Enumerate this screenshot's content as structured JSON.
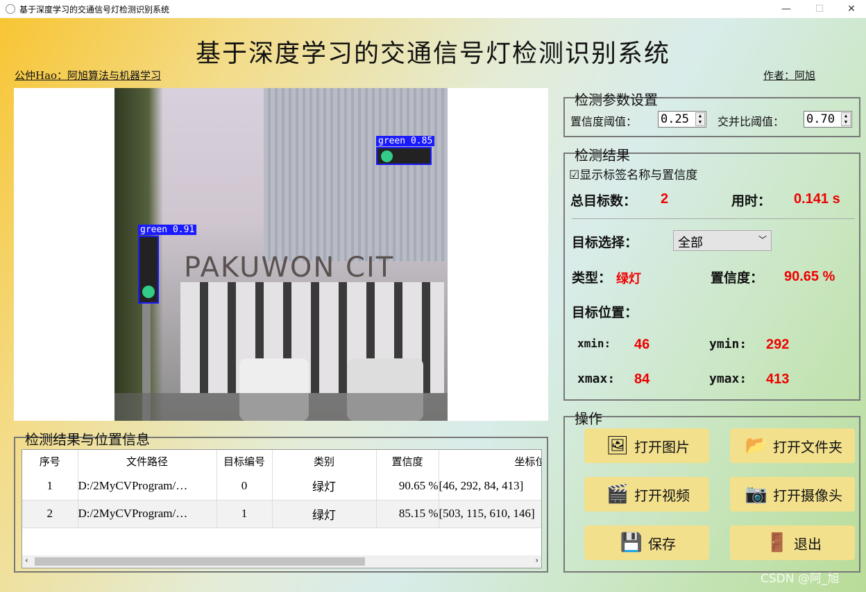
{
  "window": {
    "title": "基于深度学习的交通信号灯检测识别系统",
    "minimize": "—",
    "maximize": "☐",
    "close": "✕"
  },
  "header": {
    "title": "基于深度学习的交通信号灯检测识别系统",
    "left_note": "公仲Hao：阿旭算法与机器学习",
    "right_note": "作者：阿旭"
  },
  "image": {
    "detections": [
      {
        "label": "green 0.91"
      },
      {
        "label": "green 0.85"
      }
    ],
    "sign_text": "PAKUWON CIT"
  },
  "params": {
    "title": "检测参数设置",
    "conf_label": "置信度阈值：",
    "conf_value": "0.25",
    "iou_label": "交并比阈值：",
    "iou_value": "0.70"
  },
  "results": {
    "title": "检测结果",
    "show_labels": "显示标签名称与置信度",
    "show_labels_checked": true,
    "total_label": "总目标数：",
    "total_value": "2",
    "time_label": "用时：",
    "time_value": "0.141 s",
    "select_label": "目标选择：",
    "select_value": "全部",
    "type_label": "类型：",
    "type_value": "绿灯",
    "conf_label": "置信度：",
    "conf_value": "90.65 %",
    "pos_label": "目标位置：",
    "xmin_label": "xmin:",
    "xmin": "46",
    "ymin_label": "ymin:",
    "ymin": "292",
    "xmax_label": "xmax:",
    "xmax": "84",
    "ymax_label": "ymax:",
    "ymax": "413"
  },
  "ops": {
    "title": "操作",
    "open_image": "打开图片",
    "open_folder": "打开文件夹",
    "open_video": "打开视频",
    "open_camera": "打开摄像头",
    "save": "保存",
    "exit": "退出"
  },
  "table": {
    "title": "检测结果与位置信息",
    "columns": [
      "序号",
      "文件路径",
      "目标编号",
      "类别",
      "置信度",
      "坐标位置"
    ],
    "rows": [
      [
        "1",
        "D:/2MyCVProgram/…",
        "0",
        "绿灯",
        "90.65 %",
        "[46, 292, 84, 413]"
      ],
      [
        "2",
        "D:/2MyCVProgram/…",
        "1",
        "绿灯",
        "85.15 %",
        "[503, 115, 610, 146]"
      ]
    ]
  },
  "watermark": "CSDN @阿_旭",
  "colors": {
    "accent_red": "#e00000",
    "box_blue": "#1a1aff",
    "button": "#f2e08c"
  }
}
